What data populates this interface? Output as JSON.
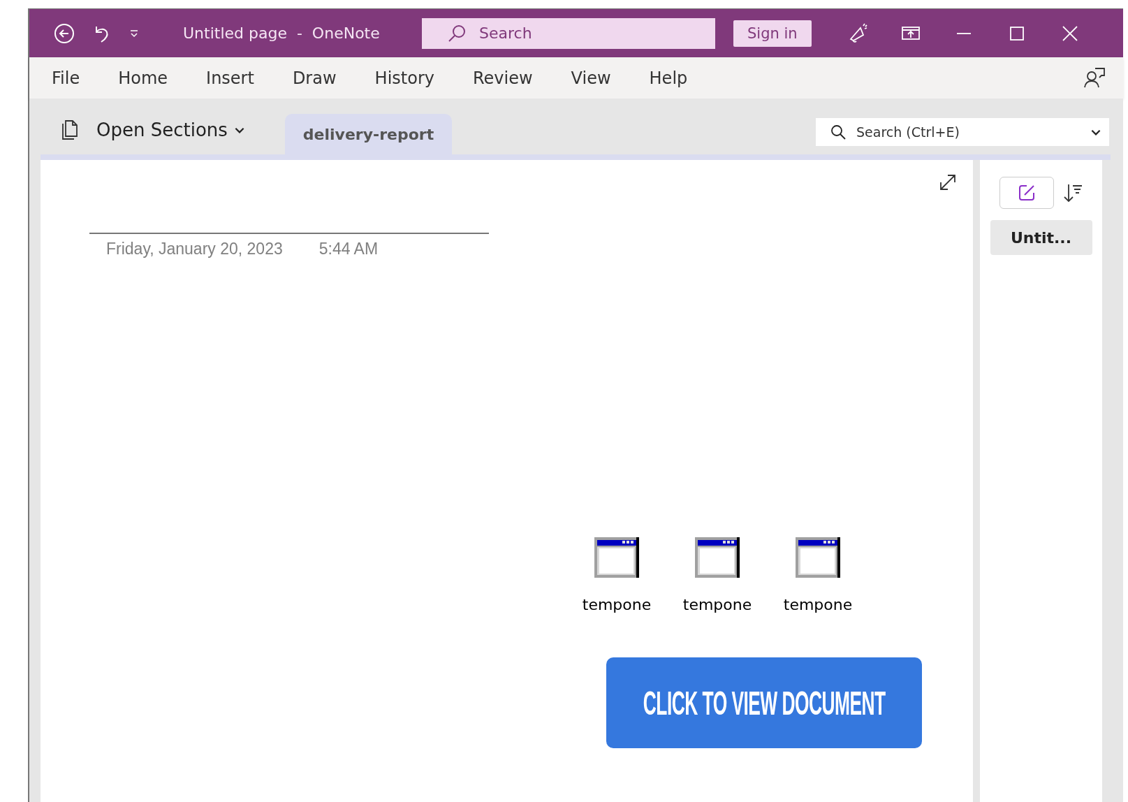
{
  "title_bar": {
    "title": "Untitled page  -  OneNote",
    "search_placeholder": "Search",
    "sign_in": "Sign in"
  },
  "menu": [
    {
      "label": "File"
    },
    {
      "label": "Home"
    },
    {
      "label": "Insert"
    },
    {
      "label": "Draw"
    },
    {
      "label": "History"
    },
    {
      "label": "Review"
    },
    {
      "label": "View"
    },
    {
      "label": "Help"
    }
  ],
  "section_bar": {
    "open_sections": "Open Sections",
    "tabs": [
      {
        "label": "delivery-report",
        "selected": true
      }
    ],
    "search_placeholder": "Search (Ctrl+E)"
  },
  "page": {
    "date": "Friday, January 20, 2023",
    "time": "5:44 AM",
    "attachments": [
      {
        "name": "tempone"
      },
      {
        "name": "tempone"
      },
      {
        "name": "tempone"
      }
    ],
    "action_button": "CLICK TO VIEW DOCUMENT"
  },
  "page_list": {
    "pages": [
      {
        "title": "Untit...",
        "selected": true
      }
    ]
  }
}
